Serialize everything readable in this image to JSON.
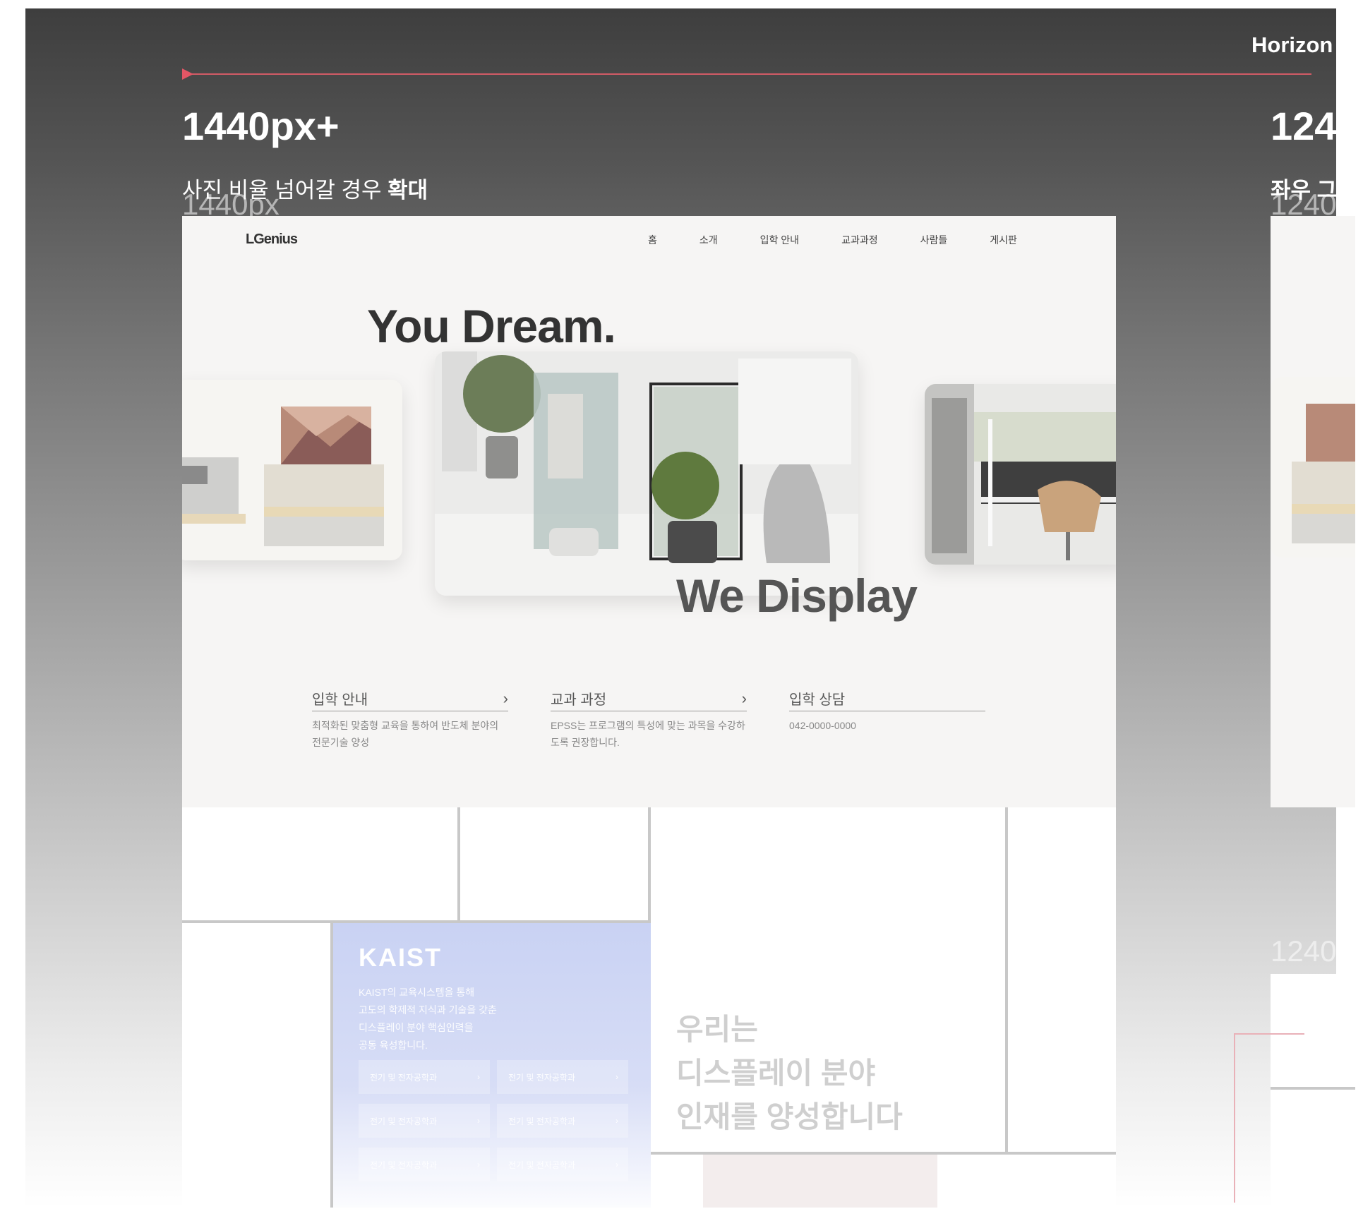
{
  "board": {
    "top_right_label": "Horizon",
    "breakpoints": [
      {
        "title": "1440px+",
        "subtitle_plain": "사진 비율 넘어갈 경우 ",
        "subtitle_bold": "확대",
        "frame_label": "1440px"
      },
      {
        "title": "124",
        "subtitle_bold": "좌우 그",
        "frame_label": "1240"
      }
    ],
    "second_frame_label": "1240"
  },
  "site": {
    "logo": "LGenius",
    "nav": [
      "홈",
      "소개",
      "입학 안내",
      "교과과정",
      "사람들",
      "게시판"
    ],
    "hero_line1": "You Dream.",
    "hero_line2": "We Display",
    "info_blocks": [
      {
        "title": "입학 안내",
        "desc": "최적화된 맞춤형 교육을 통하여 반도체 분야의 전문기술 양성"
      },
      {
        "title": "교과 과정",
        "desc": "EPSS는 프로그램의 특성에 맞는 과목을 수강하도록 권장합니다."
      },
      {
        "title": "입학 상담",
        "desc": "042-0000-0000"
      }
    ],
    "kaist": {
      "logo": "KAIST",
      "desc": "KAIST의 교육시스템을 통해\n고도의 학제적 지식과 기술을 갖춘\n디스플레이 분야 핵심인력을\n공동 육성합니다.",
      "buttons": [
        "전기 및 전자공학과",
        "전기 및 전자공학과",
        "전기 및 전자공학과",
        "전기 및 전자공학과",
        "전기 및 전자공학과",
        "전기 및 전자공학과"
      ]
    },
    "slogan": "우리는\n디스플레이 분야\n인재를 양성합니다"
  },
  "colors": {
    "accent_line": "#d25b66",
    "kaist_panel": "#c9d2f3"
  },
  "icons": {
    "chevron": "chevron-right-icon",
    "marker": "triangle-right-icon"
  }
}
